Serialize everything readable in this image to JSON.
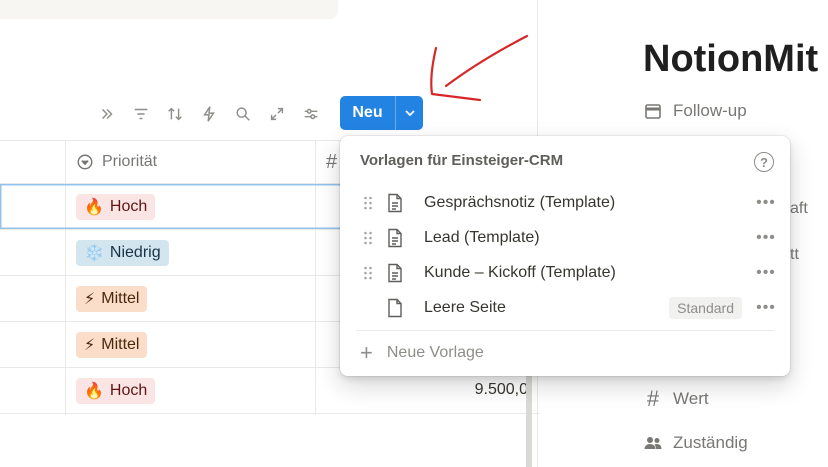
{
  "toolbar": {
    "icons": [
      "expand-sidebar-icon",
      "filter-icon",
      "sort-icon",
      "automation-icon",
      "search-icon",
      "open-fullpage-icon",
      "settings-icon"
    ],
    "new_button": {
      "label": "Neu"
    }
  },
  "table": {
    "columns": {
      "priority_label": "Priorität",
      "value_symbol": "#"
    },
    "rows": [
      {
        "priority": "Hoch",
        "emoji": "🔥",
        "level": "high",
        "value": ""
      },
      {
        "priority": "Niedrig",
        "emoji": "❄️",
        "level": "low",
        "value": ""
      },
      {
        "priority": "Mittel",
        "emoji": "⚡",
        "level": "mid",
        "value": ""
      },
      {
        "priority": "Mittel",
        "emoji": "⚡",
        "level": "mid",
        "value": ""
      },
      {
        "priority": "Hoch",
        "emoji": "🔥",
        "level": "high",
        "value": "9.500,0"
      }
    ]
  },
  "page": {
    "title": "NotionMit",
    "properties": {
      "followup": "Follow-up",
      "value": "Wert",
      "owner": "Zuständig"
    },
    "partial_texts": [
      "aft",
      "tt"
    ]
  },
  "dropdown": {
    "title": "Vorlagen für Einsteiger-CRM",
    "help": "?",
    "items": [
      {
        "label": "Gesprächsnotiz (Template)",
        "badge": ""
      },
      {
        "label": "Lead (Template)",
        "badge": ""
      },
      {
        "label": "Kunde – Kickoff (Template)",
        "badge": ""
      },
      {
        "label": "Leere Seite",
        "badge": "Standard"
      }
    ],
    "new_template": "Neue Vorlage"
  },
  "colors": {
    "accent": "#2383e2",
    "annotation": "#d62828"
  }
}
